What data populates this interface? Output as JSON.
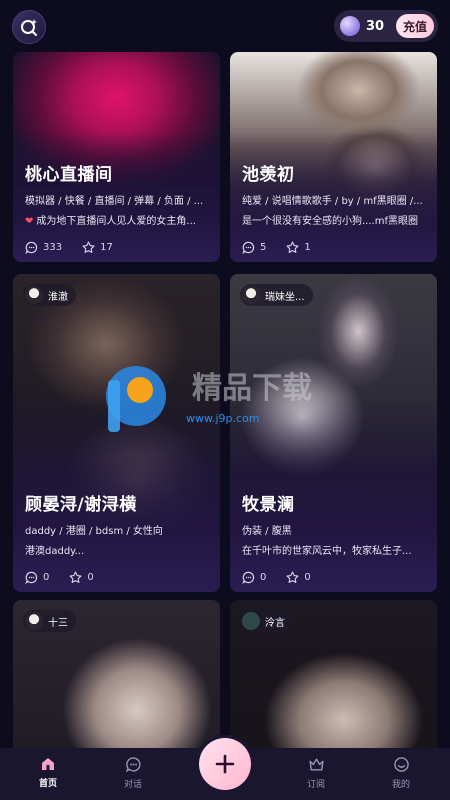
{
  "header": {
    "coins": "30",
    "recharge_label": "充值"
  },
  "cards": [
    {
      "title": "桃心直播间",
      "tags": "模拟器 / 快餐 / 直播间 / 弹幕 / 负面 / ...",
      "desc": "成为地下直播间人见人爱的女主角...",
      "comments": "333",
      "stars": "17"
    },
    {
      "title": "池羡初",
      "tags": "纯爱 / 说唱情歌歌手 / by / mf黑眼圈 /...",
      "desc": "是一个很没有安全感的小狗....mf黑眼圈",
      "comments": "5",
      "stars": "1"
    },
    {
      "author": "淮澈",
      "title": "顾晏浔/谢浔横",
      "tags": "daddy / 港圈 / bdsm / 女性向",
      "desc": "港澳daddy...",
      "comments": "0",
      "stars": "0"
    },
    {
      "author": "瑞妹坐...",
      "title": "牧景澜",
      "tags": "伪装 / 腹黑",
      "desc": "在千叶市的世家风云中，牧家私生子...",
      "comments": "0",
      "stars": "0"
    },
    {
      "author": "十三"
    },
    {
      "author": "泠言"
    }
  ],
  "watermark": {
    "text": "精品下载",
    "url": "www.j9p.com"
  },
  "nav": {
    "home": "首页",
    "chat": "对话",
    "subscribe": "订阅",
    "mine": "我的"
  },
  "colors": {
    "background": "#0d0b1e",
    "card_gradient": "#2a1d52",
    "accent_pink": "#ffb6cf",
    "heart": "#ff4d6d"
  }
}
